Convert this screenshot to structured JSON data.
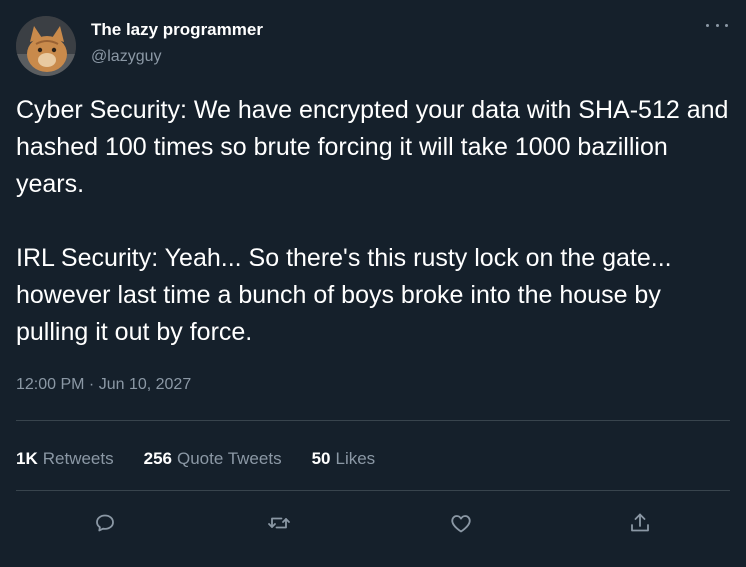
{
  "user": {
    "name": "The lazy programmer",
    "handle": "@lazyguy"
  },
  "tweet": {
    "paragraphs": [
      "Cyber Security: We have encrypted your data with SHA-512 and hashed 100 times so brute forcing it will take 1000 bazillion years.",
      "IRL Security: Yeah... So there's this rusty lock on the gate... however last time a bunch of boys broke into the house by pulling it out by force."
    ],
    "timestamp": "12:00 PM · Jun 10, 2027"
  },
  "stats": {
    "retweets": {
      "count": "1K",
      "label": "Retweets"
    },
    "quotes": {
      "count": "256",
      "label": "Quote Tweets"
    },
    "likes": {
      "count": "50",
      "label": "Likes"
    }
  },
  "icons": {
    "more": "more-icon",
    "reply": "reply-icon",
    "retweet": "retweet-icon",
    "like": "like-icon",
    "share": "share-icon"
  },
  "colors": {
    "background": "#15202b",
    "secondary_text": "#8b98a5",
    "divider": "#38444d"
  }
}
